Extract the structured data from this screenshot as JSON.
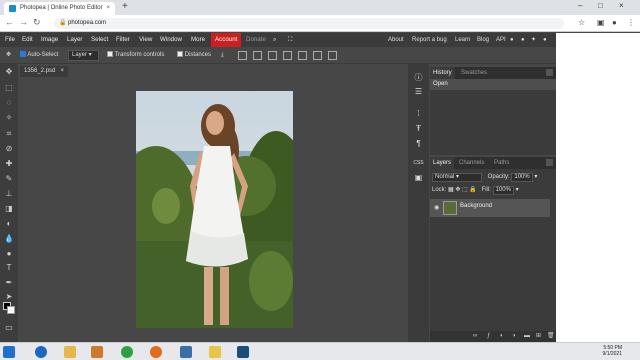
{
  "browser": {
    "tab_title": "Photopea | Online Photo Editor",
    "tab_close": "×",
    "new_tab": "+",
    "url": "photopea.com",
    "window_controls": [
      "–",
      "□",
      "×"
    ]
  },
  "menubar": {
    "items": [
      "File",
      "Edit",
      "Image",
      "Layer",
      "Select",
      "Filter",
      "View",
      "Window",
      "More"
    ],
    "account": "Account",
    "donate": "Donate",
    "right_links": [
      "About",
      "Report a bug",
      "Learn",
      "Blog",
      "API"
    ]
  },
  "options": {
    "auto_select_label": "Auto-Select",
    "auto_select_checked": true,
    "target_value": "Layer",
    "transform_controls_label": "Transform controls",
    "distances_label": "Distances"
  },
  "document": {
    "tab_name": "1356_2.psd",
    "tab_close": "×"
  },
  "history_panel": {
    "tabs": [
      "History",
      "Swatches"
    ],
    "entries": [
      "Open"
    ]
  },
  "layers_panel": {
    "tabs": [
      "Layers",
      "Channels",
      "Paths"
    ],
    "blend_mode": "Normal",
    "opacity_label": "Opacity:",
    "opacity_value": "100%",
    "lock_label": "Lock:",
    "fill_label": "Fill:",
    "fill_value": "100%",
    "layers": [
      "Background"
    ]
  },
  "taskbar": {
    "time": "5:50 PM",
    "date": "9/1/2021"
  },
  "colors": {
    "account_accent": "#cc1f1f",
    "panel_bg": "#3b3b3b",
    "workspace_bg": "#474747"
  }
}
